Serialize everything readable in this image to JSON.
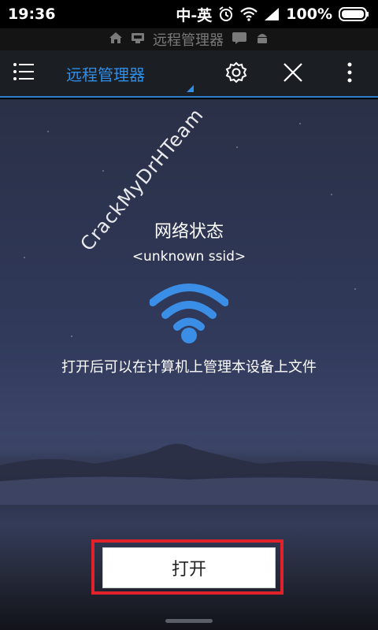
{
  "status_bar": {
    "time": "19:36",
    "ime": "中-英",
    "battery": "100%",
    "icons": [
      "alarm-icon",
      "wifi-icon",
      "signal-icon",
      "battery-icon"
    ]
  },
  "nav_strip": {
    "title": "远程管理器",
    "icons": [
      "home-icon",
      "remote-icon",
      "message-icon",
      "android-icon"
    ]
  },
  "app_bar": {
    "title": "远程管理器",
    "icons": [
      "menu-icon",
      "settings-icon",
      "close-icon",
      "more-icon"
    ],
    "accent": "#2f8fe8"
  },
  "content": {
    "network_status_title": "网络状态",
    "ssid": "<unknown ssid>",
    "description": "打开后可以在计算机上管理本设备上文件",
    "watermark": "CrackMyDrHTeam",
    "wifi_color": "#3a8ee6"
  },
  "primary_action": {
    "label": "打开",
    "highlight_color": "#e0232b"
  }
}
